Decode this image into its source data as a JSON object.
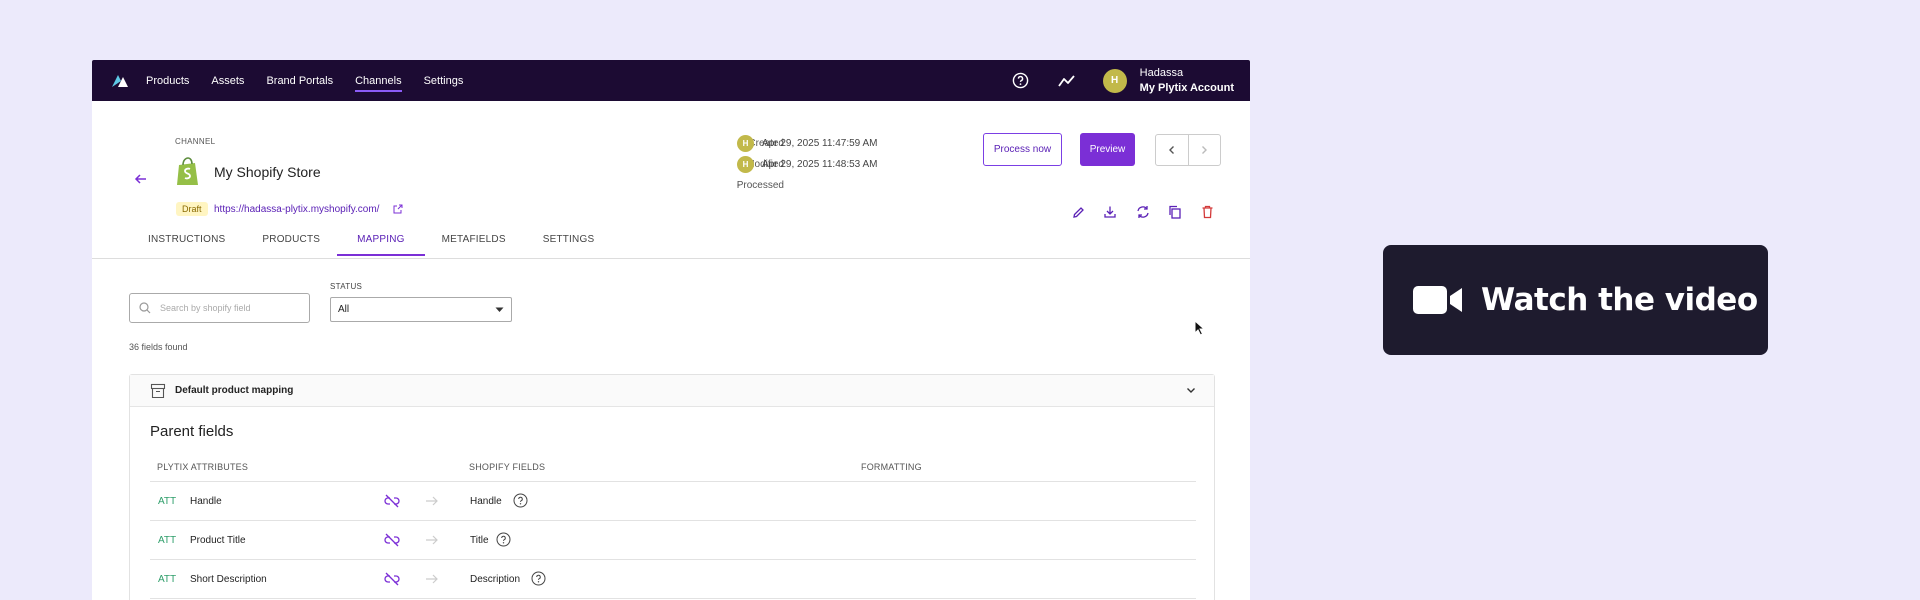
{
  "nav": {
    "items": [
      {
        "label": "Products",
        "active": false
      },
      {
        "label": "Assets",
        "active": false
      },
      {
        "label": "Brand Portals",
        "active": false
      },
      {
        "label": "Channels",
        "active": true
      },
      {
        "label": "Settings",
        "active": false
      }
    ],
    "help_icon": "question-circle-icon",
    "activity_icon": "activity-icon",
    "user": {
      "avatar_initial": "H",
      "name": "Hadassa",
      "account": "My Plytix Account"
    }
  },
  "channel": {
    "section_label": "CHANNEL",
    "name": "My Shopify Store",
    "status": "Draft",
    "url": "https://hadassa-plytix.myshopify.com/",
    "meta": {
      "created_label": "Created",
      "created_avatar": "H",
      "created_value": "Apr 29, 2025 11:47:59 AM",
      "modified_label": "Modified",
      "modified_avatar": "H",
      "modified_value": "Apr 29, 2025 11:48:53 AM",
      "processed_label": "Processed",
      "processed_value": "-"
    },
    "buttons": {
      "process_now": "Process now",
      "preview": "Preview"
    }
  },
  "tabs": [
    {
      "label": "INSTRUCTIONS",
      "active": false
    },
    {
      "label": "PRODUCTS",
      "active": false
    },
    {
      "label": "MAPPING",
      "active": true
    },
    {
      "label": "METAFIELDS",
      "active": false
    },
    {
      "label": "SETTINGS",
      "active": false
    }
  ],
  "filters": {
    "search_placeholder": "Search by shopify field",
    "status_label": "STATUS",
    "status_value": "All",
    "found_text": "36 fields found"
  },
  "mapping": {
    "section_title": "Default product mapping",
    "parent_title": "Parent fields",
    "columns": {
      "plytix": "PLYTIX ATTRIBUTES",
      "shopify": "SHOPIFY FIELDS",
      "formatting": "FORMATTING"
    },
    "rows": [
      {
        "type": "ATT",
        "attribute": "Handle",
        "shopify_field": "Handle"
      },
      {
        "type": "ATT",
        "attribute": "Product Title",
        "shopify_field": "Title"
      },
      {
        "type": "ATT",
        "attribute": "Short Description",
        "shopify_field": "Description"
      }
    ]
  },
  "video": {
    "label": "Watch the video"
  },
  "colors": {
    "navbar": "#1C0B33",
    "accent": "#7B2FD6",
    "avatar": "#C2B94A",
    "att_green": "#2E9E6A",
    "delete_red": "#D33A3A"
  }
}
